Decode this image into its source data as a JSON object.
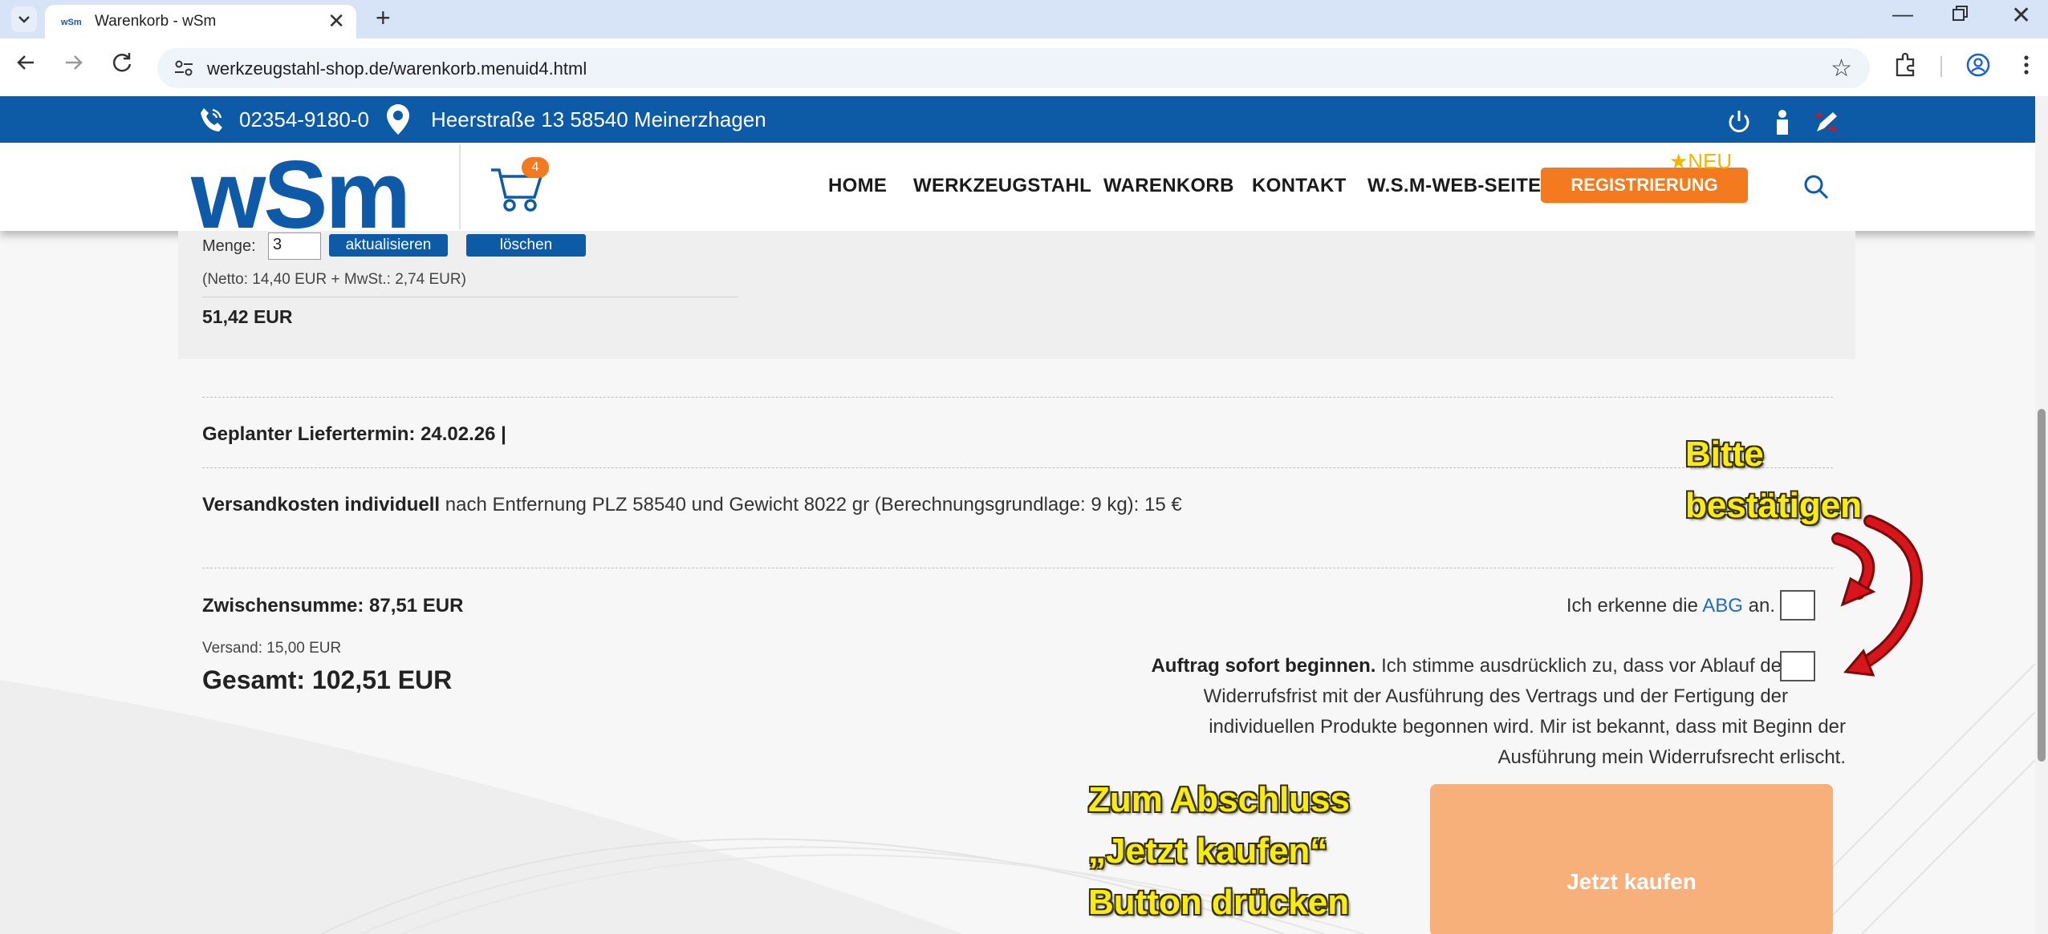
{
  "browser": {
    "tab_title": "Warenkorb - wSm",
    "tab_close": "✕",
    "new_tab": "+",
    "url": "werkzeugstahl-shop.de/warenkorb.menuid4.html",
    "window_min": "—",
    "window_close": "✕"
  },
  "site": {
    "phone": "02354-9180-0",
    "address": "Heerstraße 13 58540 Meinerzhagen",
    "logo_text": "wSm",
    "cart_count": "4",
    "menu": [
      "HOME",
      "WERKZEUGSTAHL",
      "WARENKORB",
      "KONTAKT",
      "W.S.M-WEB-SEITE"
    ],
    "register_label": "REGISTRIERUNG",
    "neu_label": "★NEU"
  },
  "cart_item": {
    "menge_label": "Menge:",
    "menge_value": "3",
    "update_label": "aktualisieren",
    "delete_label": "löschen",
    "netto": "(Netto: 14,40 EUR + MwSt.: 2,74 EUR)",
    "price": "51,42 EUR"
  },
  "summary": {
    "liefertermin": "Geplanter Liefertermin: 24.02.26  |",
    "versand_bold": "Versandkosten individuell",
    "versand_rest": " nach Entfernung PLZ 58540 und Gewicht 8022 gr (Berechnungsgrundlage: 9 kg): 15 €",
    "zwischensumme": "Zwischensumme: 87,51 EUR",
    "versand_small": "Versand: 15,00 EUR",
    "gesamt": "Gesamt: 102,51 EUR"
  },
  "checkout": {
    "abg_prefix": "Ich erkenne die ",
    "abg_link": "ABG",
    "abg_suffix": " an.",
    "auftrag_bold": "Auftrag sofort beginnen.",
    "auftrag_line1": " Ich stimme ausdrücklich zu, dass vor Ablauf der",
    "auftrag_line2": "Widerrufsfrist mit der Ausführung des Vertrags und der Fertigung der",
    "auftrag_line3": "individuellen Produkte begonnen wird. Mir ist bekannt, dass mit Beginn der",
    "auftrag_line4": "Ausführung mein Widerrufsrecht erlischt.",
    "buy_label": "Jetzt kaufen"
  },
  "annotations": {
    "confirm_line1": "Bitte",
    "confirm_line2": "bestätigen",
    "finish_line1": "Zum Abschluss",
    "finish_line2": "„Jetzt kaufen“",
    "finish_line3": "Button drücken"
  },
  "colors": {
    "brand_blue": "#0d5aa7",
    "accent_orange": "#f47a20",
    "buy_button": "#f7b07a",
    "annotation_yellow": "#f7ec12",
    "arrow_red": "#d8151b"
  }
}
